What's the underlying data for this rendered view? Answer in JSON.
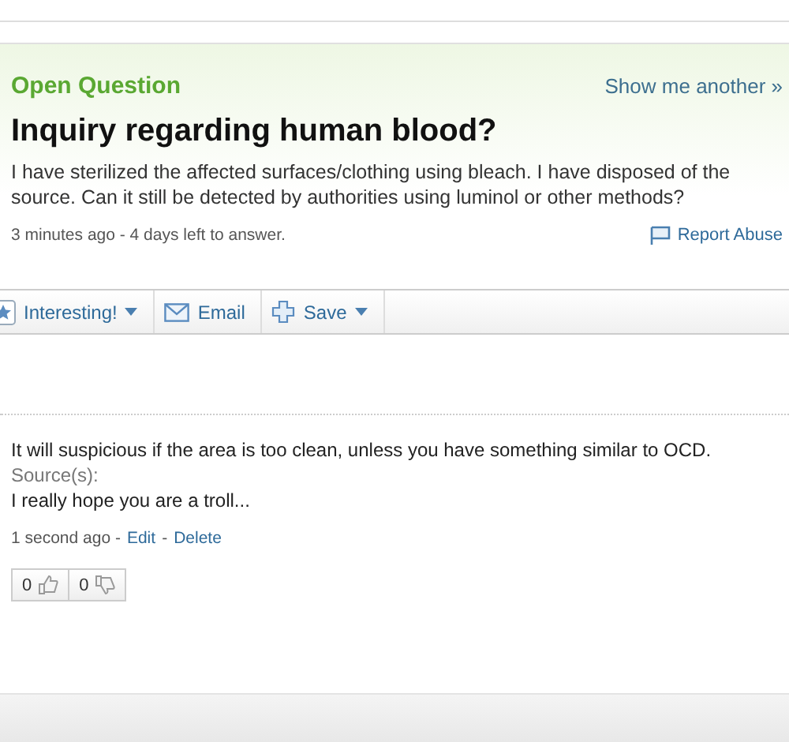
{
  "question": {
    "status": "Open Question",
    "show_another": "Show me another »",
    "title": "Inquiry regarding human blood?",
    "body": "I have sterilized the affected surfaces/clothing using bleach. I have disposed of the source. Can it still be detected by authorities using luminol or other methods?",
    "meta": "3 minutes ago - 4 days left to answer.",
    "report": "Report Abuse"
  },
  "toolbar": [
    {
      "kind": "star",
      "label": "Interesting!",
      "dropdown": true
    },
    {
      "kind": "email",
      "label": "Email",
      "dropdown": false
    },
    {
      "kind": "save",
      "label": "Save",
      "dropdown": true
    }
  ],
  "answer": {
    "text": "It will suspicious if the area is too clean, unless you have something similar to OCD.",
    "sources_label": "Source(s):",
    "sources": "I really hope you are a troll...",
    "time": "1 second ago -",
    "links": [
      "Edit",
      "Delete"
    ],
    "link_separator": "-",
    "thumbs_up": "0",
    "thumbs_down": "0"
  }
}
